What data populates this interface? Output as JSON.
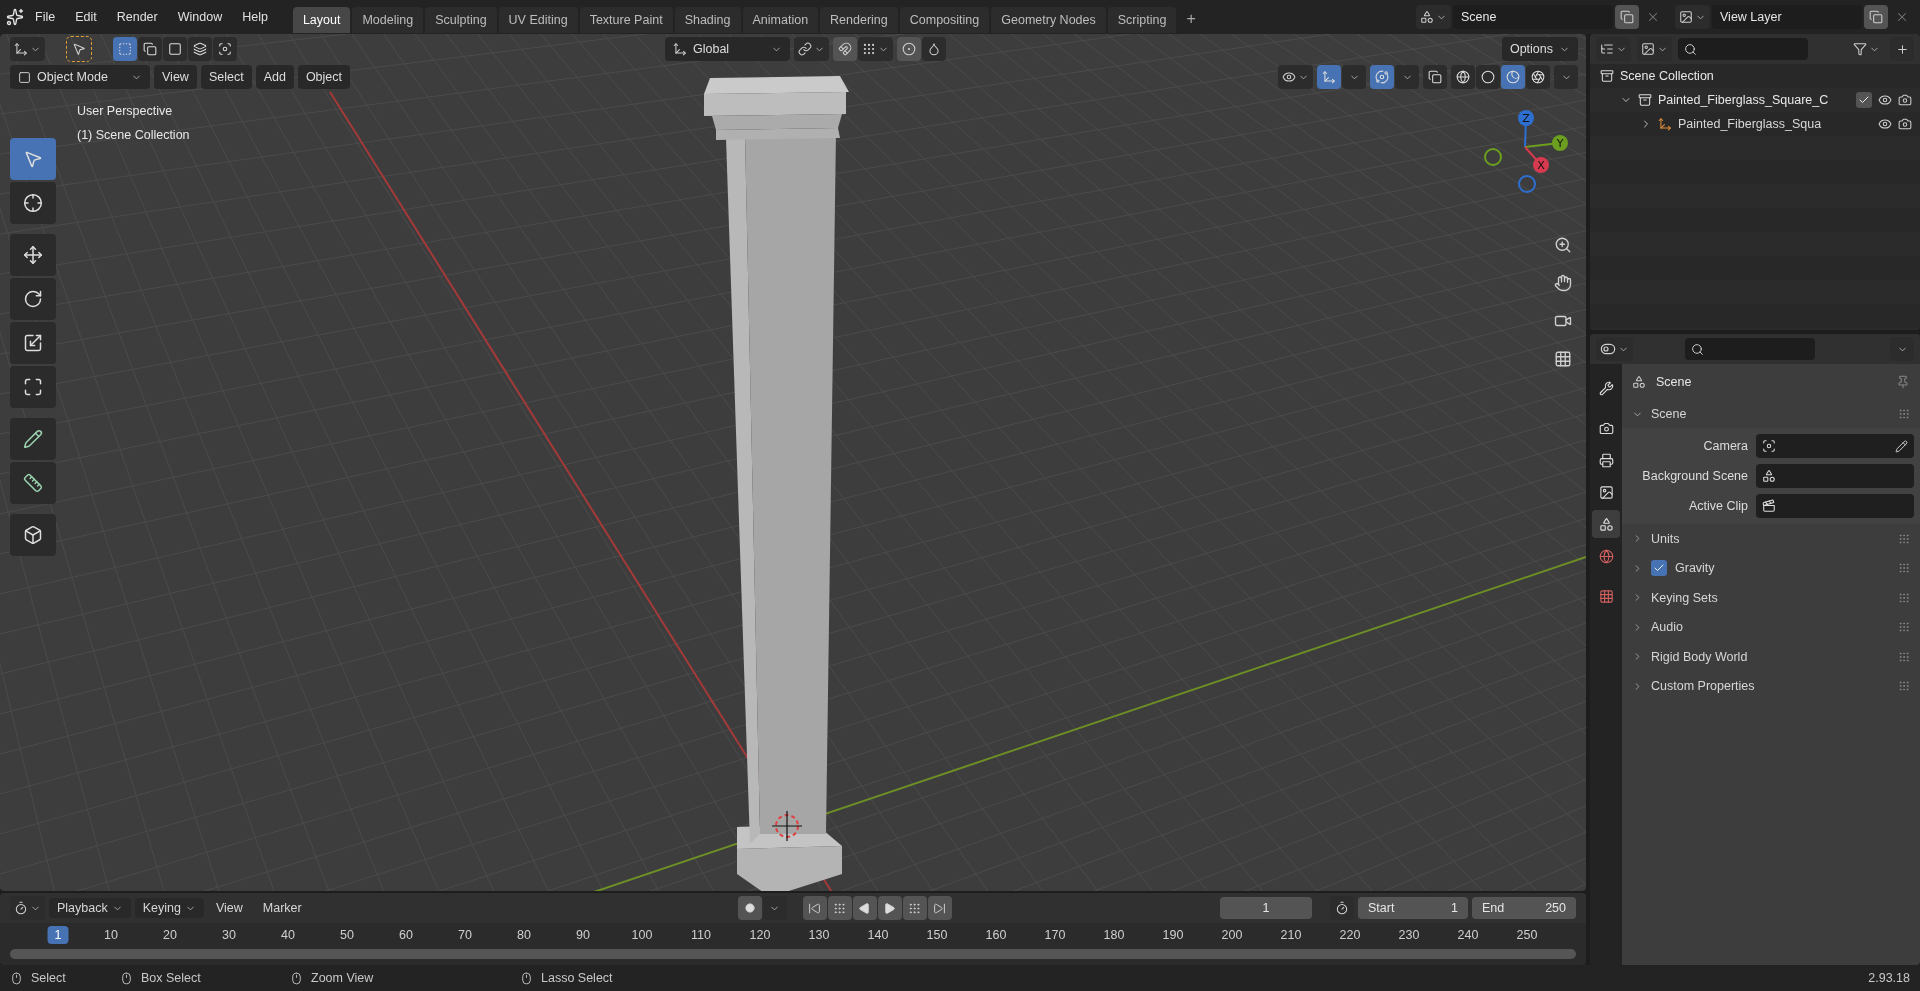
{
  "menu": [
    "File",
    "Edit",
    "Render",
    "Window",
    "Help"
  ],
  "workspaces": [
    {
      "label": "Layout",
      "selected": true
    },
    {
      "label": "Modeling",
      "selected": false
    },
    {
      "label": "Sculpting",
      "selected": false
    },
    {
      "label": "UV Editing",
      "selected": false
    },
    {
      "label": "Texture Paint",
      "selected": false
    },
    {
      "label": "Shading",
      "selected": false
    },
    {
      "label": "Animation",
      "selected": false
    },
    {
      "label": "Rendering",
      "selected": false
    },
    {
      "label": "Compositing",
      "selected": false
    },
    {
      "label": "Geometry Nodes",
      "selected": false
    },
    {
      "label": "Scripting",
      "selected": false
    }
  ],
  "add_workspace": "+",
  "scene_field": {
    "value": "Scene"
  },
  "view_layer_field": {
    "value": "View Layer"
  },
  "viewport": {
    "select_modes": [
      {
        "kind": "set",
        "selected": true
      },
      {
        "kind": "extend",
        "selected": false
      },
      {
        "kind": "subtract",
        "selected": false
      },
      {
        "kind": "difference",
        "selected": false
      },
      {
        "kind": "intersect",
        "selected": false
      }
    ],
    "orientation": "Global",
    "options": "Options",
    "mode": "Object Mode",
    "menus": [
      "View",
      "Select",
      "Add",
      "Object"
    ],
    "toggles": [
      {
        "kind": "gizmos",
        "on": true
      },
      {
        "kind": "overlays",
        "on": true
      },
      {
        "kind": "xray",
        "on": false
      }
    ],
    "shading": [
      {
        "kind": "wireframe",
        "selected": false
      },
      {
        "kind": "solid",
        "selected": false
      },
      {
        "kind": "material",
        "selected": true
      },
      {
        "kind": "rendered",
        "selected": false
      }
    ],
    "overlay_text": [
      "User Perspective",
      "(1) Scene Collection"
    ],
    "tools": [
      {
        "kind": "select",
        "selected": true
      },
      {
        "kind": "cursor",
        "selected": false
      },
      {
        "kind": "move",
        "selected": false
      },
      {
        "kind": "rotate",
        "selected": false
      },
      {
        "kind": "scale",
        "selected": false
      },
      {
        "kind": "transform",
        "selected": false
      },
      {
        "kind": "annotate",
        "selected": false
      },
      {
        "kind": "measure",
        "selected": false
      },
      {
        "kind": "add-cube",
        "selected": false
      }
    ],
    "gizmo_axes": [
      {
        "label": "Z",
        "color": "#2c6fd1"
      },
      {
        "label": "Y",
        "color": "#6c9e1f"
      },
      {
        "label": "X",
        "color": "#d63a4f"
      }
    ]
  },
  "outliner": {
    "items": [
      {
        "label": "Scene Collection",
        "children": [
          {
            "label": "Painted_Fiberglass_Square_C",
            "kind": "collection",
            "expanded": true,
            "checked": true,
            "children": [
              {
                "label": "Painted_Fiberglass_Squa",
                "kind": "empty",
                "expanded": false
              }
            ]
          }
        ]
      }
    ]
  },
  "properties": {
    "context": "Scene",
    "tabs": [
      {
        "kind": "tool",
        "selected": false
      },
      {
        "kind": "render",
        "selected": false
      },
      {
        "kind": "output",
        "selected": false
      },
      {
        "kind": "view-layer",
        "selected": false
      },
      {
        "kind": "scene",
        "selected": true
      },
      {
        "kind": "world",
        "selected": false
      },
      {
        "kind": "texture",
        "selected": false
      }
    ],
    "panel": {
      "title": "Scene",
      "expanded": true,
      "fields": [
        {
          "label": "Camera",
          "kind": "camera"
        },
        {
          "label": "Background Scene",
          "kind": "scene"
        },
        {
          "label": "Active Clip",
          "kind": "clip"
        }
      ]
    },
    "subpanels": [
      {
        "label": "Units",
        "kind": "plain"
      },
      {
        "label": "Gravity",
        "kind": "checkbox",
        "checked": true
      },
      {
        "label": "Keying Sets",
        "kind": "plain"
      },
      {
        "label": "Audio",
        "kind": "plain"
      },
      {
        "label": "Rigid Body World",
        "kind": "plain"
      },
      {
        "label": "Custom Properties",
        "kind": "plain"
      }
    ]
  },
  "timeline": {
    "menus": [
      {
        "label": "Playback",
        "dropdown": true
      },
      {
        "label": "Keying",
        "dropdown": true
      },
      {
        "label": "View",
        "dropdown": false
      },
      {
        "label": "Marker",
        "dropdown": false
      }
    ],
    "current_frame": "1",
    "start_label": "Start",
    "start": "1",
    "end_label": "End",
    "end": "250",
    "playhead": "1",
    "ruler": [
      "10",
      "20",
      "30",
      "40",
      "50",
      "60",
      "70",
      "80",
      "90",
      "100",
      "110",
      "120",
      "130",
      "140",
      "150",
      "160",
      "170",
      "180",
      "190",
      "200",
      "210",
      "220",
      "230",
      "240",
      "250"
    ]
  },
  "status_bar": {
    "hints": [
      "Select",
      "Box Select",
      "Zoom View",
      "Lasso Select"
    ],
    "version": "2.93.18"
  }
}
